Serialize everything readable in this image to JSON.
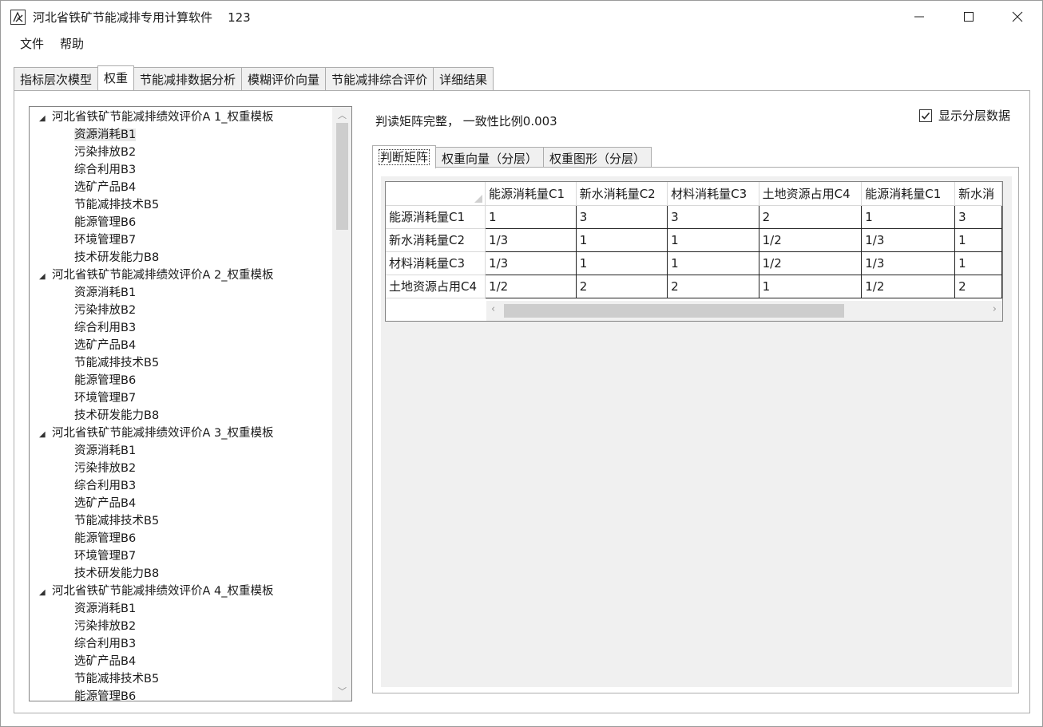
{
  "window": {
    "title": "河北省铁矿节能减排专用计算软件    123"
  },
  "menu": [
    "文件",
    "帮助"
  ],
  "main_tabs": [
    "指标层次模型",
    "权重",
    "节能减排数据分析",
    "模糊评价向量",
    "节能减排综合评价",
    "详细结果"
  ],
  "main_tab_active": "权重",
  "tree": {
    "groups": [
      {
        "label": "河北省铁矿节能减排绩效评价A   1_权重模板",
        "children": [
          "资源消耗B1",
          "污染排放B2",
          "综合利用B3",
          "选矿产品B4",
          "节能减排技术B5",
          "能源管理B6",
          "环境管理B7",
          "技术研发能力B8"
        ]
      },
      {
        "label": "河北省铁矿节能减排绩效评价A   2_权重模板",
        "children": [
          "资源消耗B1",
          "污染排放B2",
          "综合利用B3",
          "选矿产品B4",
          "节能减排技术B5",
          "能源管理B6",
          "环境管理B7",
          "技术研发能力B8"
        ]
      },
      {
        "label": "河北省铁矿节能减排绩效评价A   3_权重模板",
        "children": [
          "资源消耗B1",
          "污染排放B2",
          "综合利用B3",
          "选矿产品B4",
          "节能减排技术B5",
          "能源管理B6",
          "环境管理B7",
          "技术研发能力B8"
        ]
      },
      {
        "label": "河北省铁矿节能减排绩效评价A   4_权重模板",
        "children": [
          "资源消耗B1",
          "污染排放B2",
          "综合利用B3",
          "选矿产品B4",
          "节能减排技术B5",
          "能源管理B6"
        ]
      }
    ],
    "expand_glyph": "◢",
    "scroll_up": "︿",
    "scroll_down": "﹀"
  },
  "status": "判读矩阵完整，  一致性比例0.003",
  "show_layer": {
    "label": "显示分层数据",
    "checked": true
  },
  "sub_tabs": [
    "判断矩阵",
    "权重向量（分层）",
    "权重图形（分层）"
  ],
  "sub_tab_active": "判断矩阵",
  "matrix": {
    "columns": [
      "能源消耗量C1",
      "新水消耗量C2",
      "材料消耗量C3",
      "土地资源占用C4",
      "能源消耗量C1",
      "新水消"
    ],
    "rows": [
      {
        "header": "能源消耗量C1",
        "cells": [
          "1",
          "3",
          "3",
          "2",
          "1",
          "3"
        ]
      },
      {
        "header": "新水消耗量C2",
        "cells": [
          "1/3",
          "1",
          "1",
          "1/2",
          "1/3",
          "1"
        ]
      },
      {
        "header": "材料消耗量C3",
        "cells": [
          "1/3",
          "1",
          "1",
          "1/2",
          "1/3",
          "1"
        ]
      },
      {
        "header": "土地资源占用C4",
        "cells": [
          "1/2",
          "2",
          "2",
          "1",
          "1/2",
          "2"
        ]
      }
    ],
    "scroll_left": "‹",
    "scroll_right": "›"
  }
}
